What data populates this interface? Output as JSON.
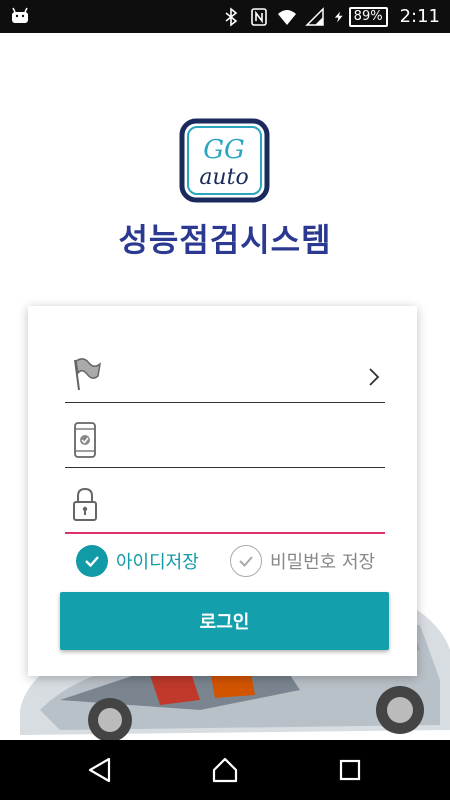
{
  "status_bar": {
    "left_icon": "android-icon",
    "icons": [
      "bluetooth-icon",
      "nfc-icon",
      "wifi-icon",
      "signal-icon",
      "charging-icon"
    ],
    "battery_percent": "89%",
    "time": "2:11"
  },
  "logo": {
    "text_top": "GG",
    "text_bottom": "auto"
  },
  "app_title": "성능점검시스템",
  "form": {
    "fields": [
      {
        "icon": "flag-icon",
        "value": "",
        "has_chevron": true
      },
      {
        "icon": "phone-icon",
        "value": ""
      },
      {
        "icon": "lock-icon",
        "value": ""
      }
    ],
    "save_id": {
      "label": "아이디저장",
      "checked": true
    },
    "save_password": {
      "label": "비밀번호 저장",
      "checked": false
    },
    "login_label": "로그인"
  },
  "colors": {
    "accent": "#139fac",
    "title": "#2b3990",
    "focus_underline": "#e0306a"
  },
  "nav_bar": [
    "back-icon",
    "home-icon",
    "recents-icon"
  ]
}
